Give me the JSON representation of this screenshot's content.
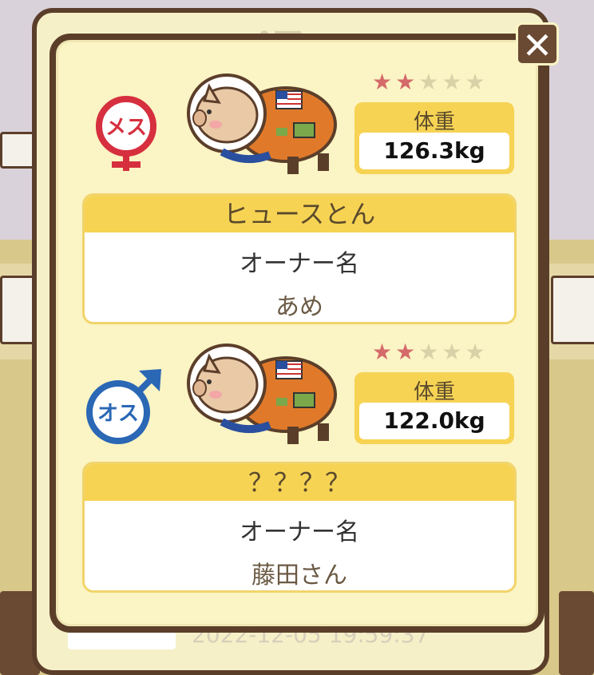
{
  "pair": [
    {
      "gender_text": "メス",
      "gender_color": "#d62f3e",
      "stars_filled": 2,
      "stars_total": 5,
      "weight_label": "体重",
      "weight_value": "126.3kg",
      "pig_name": "ヒュースとん",
      "owner_label": "オーナー名",
      "owner_name": "あめ"
    },
    {
      "gender_text": "オス",
      "gender_color": "#2a67b5",
      "stars_filled": 2,
      "stars_total": 5,
      "weight_label": "体重",
      "weight_value": "122.0kg",
      "pig_name": "？？？？",
      "owner_label": "オーナー名",
      "owner_name": "藤田さん"
    }
  ],
  "background": {
    "timestamp": "2022-12-05 19:59:37"
  },
  "icons": {
    "close": "close-icon",
    "female": "female-symbol-icon",
    "male": "male-symbol-icon",
    "pig": "astronaut-pig-icon",
    "star": "star-icon"
  }
}
